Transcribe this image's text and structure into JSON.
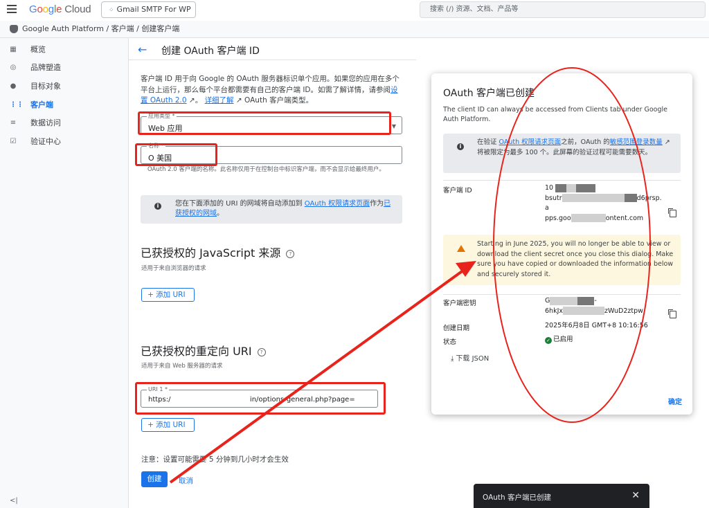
{
  "topbar": {
    "logo_parts": [
      "G",
      "o",
      "o",
      "g",
      "l",
      "e"
    ],
    "logo_cloud": "Cloud",
    "project": "Gmail SMTP For WP",
    "search_placeholder": "搜索 (/) 资源、文档、产品等"
  },
  "breadcrumb": "Google Auth Platform / 客户端 / 创建客户端",
  "sidebar": {
    "items": [
      {
        "label": "概览",
        "icon": "▦"
      },
      {
        "label": "品牌塑造",
        "icon": "◎"
      },
      {
        "label": "目标对象",
        "icon": "●"
      },
      {
        "label": "客户端",
        "icon": "⋮⋮"
      },
      {
        "label": "数据访问",
        "icon": "≡"
      },
      {
        "label": "验证中心",
        "icon": "☑"
      }
    ],
    "collapse": "<|"
  },
  "main": {
    "title": "创建 OAuth 客户端 ID",
    "desc_1": "客户端 ID 用于向 Google 的 OAuth 服务器标识单个应用。如果您的应用在多个平台上运行，那么每个平台都需要有自己的客户端 ID。如需了解详情，请参阅",
    "desc_link1": "设置 OAuth 2.0",
    "desc_sep": "。",
    "desc_link2": "详细了解",
    "desc_2": " OAuth 客户端类型。",
    "app_type_label": "应用类型 *",
    "app_type_value": "Web 应用",
    "name_label": "名称 *",
    "name_value": "O        美国",
    "name_hint": "OAuth 2.0 客户端的名称。此名称仅用于在控制台中标识客户端，而不会显示给最终用户。",
    "info_1": "您在下面添加的 URI 的网域将自动添加到 ",
    "info_link1": "OAuth 权限请求页面",
    "info_2": "作为",
    "info_link2": "已获授权的网域",
    "info_3": "。",
    "js_title": "已获授权的 JavaScript 来源",
    "js_sub": "适用于来自浏览器的请求",
    "add_uri": "+ 添加 URI",
    "redirect_title": "已获授权的重定向 URI",
    "redirect_sub": "适用于来自 Web 服务器的请求",
    "uri1_label": "URI 1 *",
    "uri1_value": "https:/                                    in/options-general.php?page=",
    "add_uri2": "+ 添加 URI",
    "note": "注意：设置可能需要 5 分钟到几小时才会生效",
    "create": "创建",
    "cancel": "取消",
    "help": "?"
  },
  "dialog": {
    "title": "OAuth 客户端已创建",
    "subtitle": "The client ID can always be accessed from Clients tab under Google Auth Platform.",
    "info_1": "在验证 ",
    "info_link1": "OAuth 权限请求页面",
    "info_2": "之前，OAuth 的",
    "info_link2": "敏感范围登录数量",
    "info_3": "将被限定为最多 100 个。此屏幕的验证过程可能需要数天。",
    "client_id_label": "客户端 ID",
    "client_id_l1": "10",
    "client_id_l2a": "bsutr",
    "client_id_l2b": "d6prsp.a",
    "client_id_l3a": "pps.goo",
    "client_id_l3b": "ontent.com",
    "warning": "Starting in June 2025, you will no longer be able to view or download the client secret once you close this dialog. Make sure you have copied or downloaded the information below and securely stored it.",
    "secret_label": "客户端密钥",
    "secret_l1a": "G",
    "secret_l1b": "-",
    "secret_l2a": "6hkJx",
    "secret_l2b": "zWuD2ztpw",
    "created_label": "创建日期",
    "created_value": "2025年6月8日 GMT+8 10:16:56",
    "status_label": "状态",
    "status_value": "已启用",
    "download": "下载 JSON",
    "ok": "确定"
  },
  "toast": {
    "text": "OAuth 客户端已创建",
    "close": "✕"
  },
  "colors": {
    "accent": "#1a73e8",
    "annotation_red": "#e8231c",
    "warning_bg": "#fef7e0",
    "success": "#188038"
  }
}
